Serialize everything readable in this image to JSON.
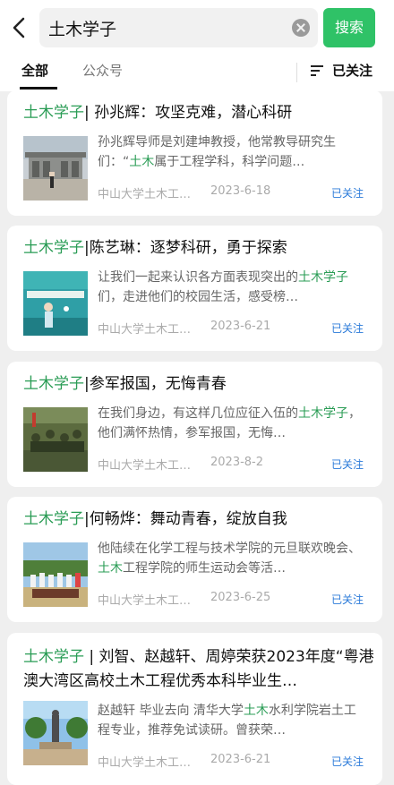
{
  "search": {
    "query": "土木学子",
    "button": "搜索"
  },
  "tabs": [
    {
      "label": "全部"
    },
    {
      "label": "公众号"
    }
  ],
  "filter_label": "已关注",
  "results": [
    {
      "title_hl": "土木学子",
      "title_rest": "| 孙兆辉：攻坚克难，潜心科研",
      "snippet_a": "孙兆辉导师是刘建坤教授，他常教导研究生们：“",
      "snippet_hl": "土木",
      "snippet_b": "属于工程学科，科学问题…",
      "source": "中山大学土木工…",
      "date": "2023-6-18",
      "status": "已关注"
    },
    {
      "title_hl": "土木学子",
      "title_rest": "|陈艺琳：逐梦科研，勇于探索",
      "snippet_a": "让我们一起来认识各方面表现突出的",
      "snippet_hl": "土木学子",
      "snippet_b": "们，走进他们的校园生活，感受榜…",
      "source": "中山大学土木工…",
      "date": "2023-6-21",
      "status": "已关注"
    },
    {
      "title_hl": "土木学子",
      "title_rest": "|参军报国，无悔青春",
      "snippet_a": "在我们身边，有这样几位应征入伍的",
      "snippet_hl": "土木学子",
      "snippet_b": "，他们满怀热情，参军报国，无悔…",
      "source": "中山大学土木工…",
      "date": "2023-8-2",
      "status": "已关注"
    },
    {
      "title_hl": "土木学子",
      "title_rest": "|何畅烨：舞动青春，绽放自我",
      "snippet_a": "他陆续在化学工程与技术学院的元旦联欢晚会、",
      "snippet_hl": "土木",
      "snippet_b": "工程学院的师生运动会等活…",
      "source": "中山大学土木工…",
      "date": "2023-6-25",
      "status": "已关注"
    },
    {
      "title_hl": "土木学子",
      "title_rest": " | 刘智、赵越轩、周婷荣获2023年度“粤港澳大湾区高校土木工程优秀本科毕业生…",
      "snippet_a": "赵越轩 毕业去向 清华大学",
      "snippet_hl": "土木",
      "snippet_b": "水利学院岩土工程专业，推荐免试读研。曾获荣…",
      "source": "中山大学土木工…",
      "date": "2023-6-21",
      "status": "已关注"
    }
  ],
  "colors": {
    "accent": "#2fc267",
    "highlight": "#2a9c55",
    "followed": "#2a7ad9"
  }
}
